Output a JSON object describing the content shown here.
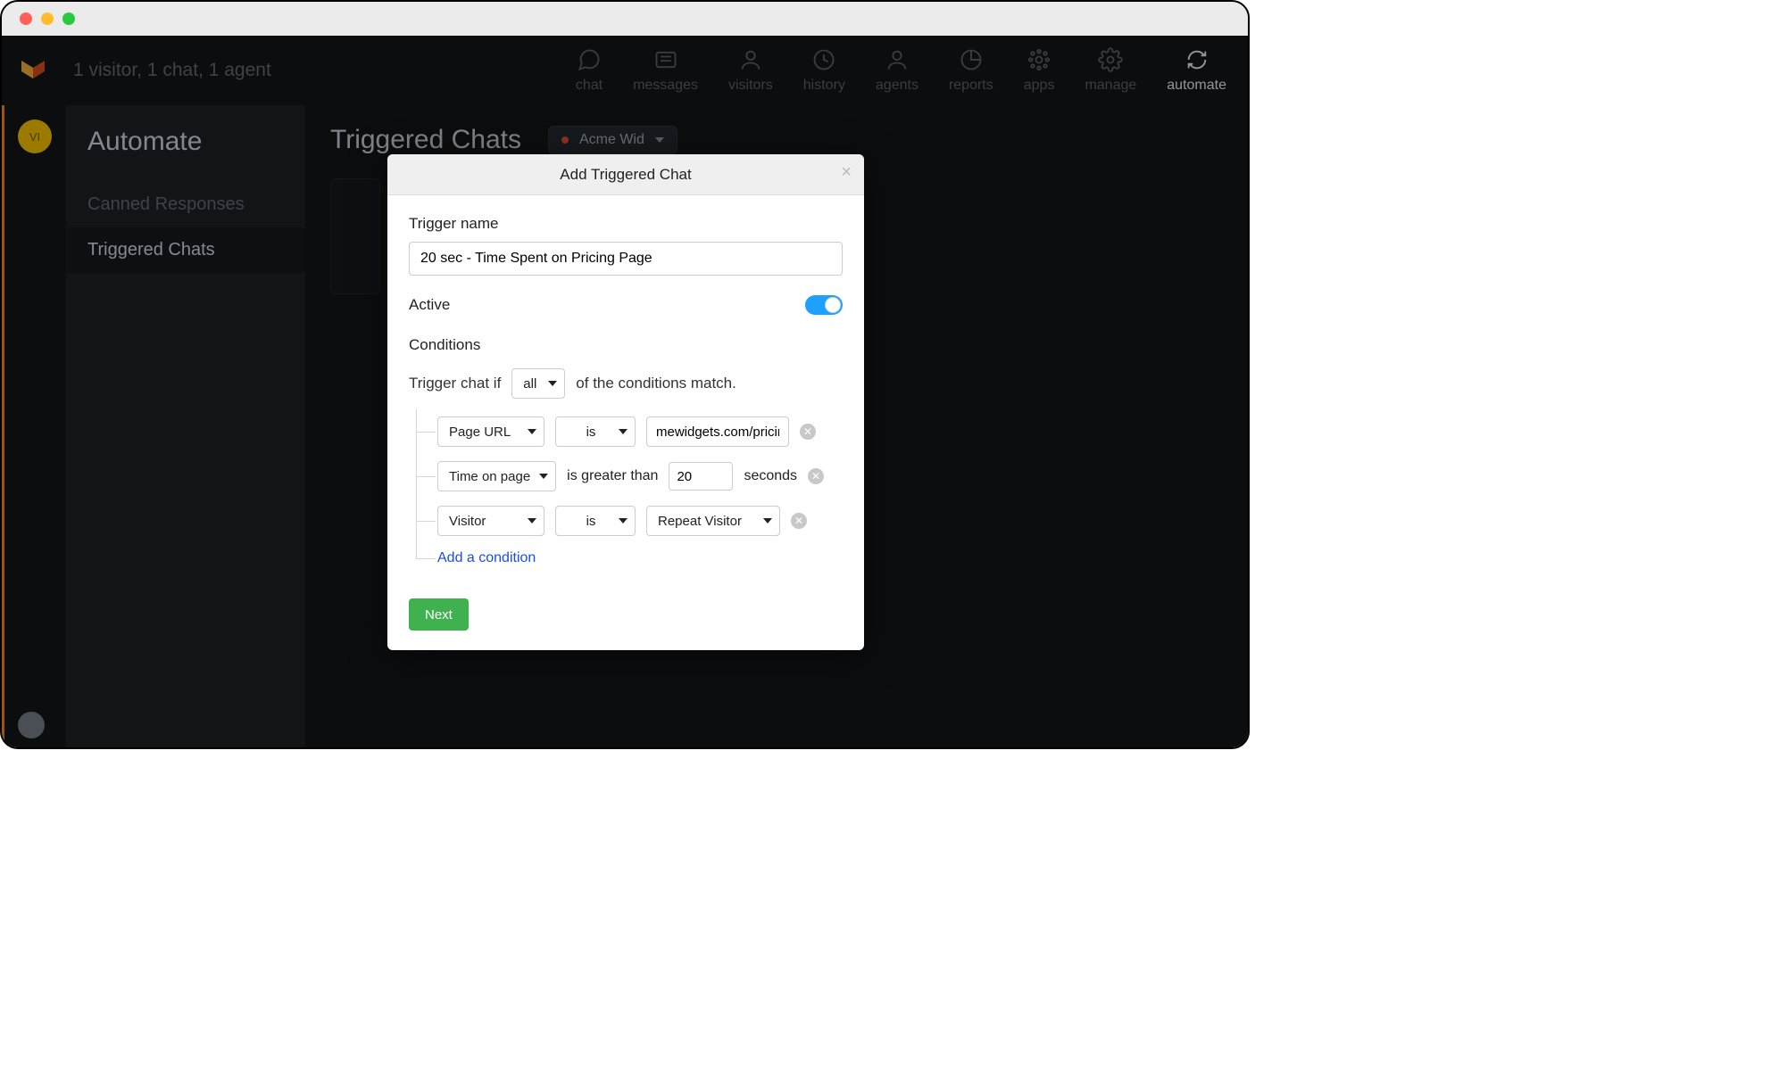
{
  "window": {
    "dot_colors": {
      "close": "#ff5f56",
      "min": "#ffbd2e",
      "max": "#27c93f"
    }
  },
  "topbar": {
    "status": "1 visitor, 1 chat, 1 agent",
    "nav": {
      "chat": "chat",
      "messages": "messages",
      "visitors": "visitors",
      "history": "history",
      "agents": "agents",
      "reports": "reports",
      "apps": "apps",
      "manage": "manage",
      "automate": "automate"
    }
  },
  "rail": {
    "avatar_initials": "VI"
  },
  "sidebar": {
    "title": "Automate",
    "items": {
      "canned": "Canned Responses",
      "triggered": "Triggered Chats"
    }
  },
  "main": {
    "heading": "Triggered Chats",
    "site_name": "Acme Wid"
  },
  "modal": {
    "title": "Add Triggered Chat",
    "trigger_name_label": "Trigger name",
    "trigger_name_value": "20 sec - Time Spent on Pricing Page",
    "active_label": "Active",
    "active_value": true,
    "conditions_label": "Conditions",
    "conditions_intro_pre": "Trigger chat if",
    "conditions_mode": "all",
    "conditions_intro_post": "of the conditions match.",
    "rows": {
      "r1": {
        "field": "Page URL",
        "op": "is",
        "value": "mewidgets.com/pricing"
      },
      "r2": {
        "field": "Time on page",
        "op_text": "is greater than",
        "value": "20",
        "unit": "seconds"
      },
      "r3": {
        "field": "Visitor",
        "op": "is",
        "value": "Repeat Visitor"
      }
    },
    "add_condition": "Add a condition",
    "next": "Next"
  }
}
